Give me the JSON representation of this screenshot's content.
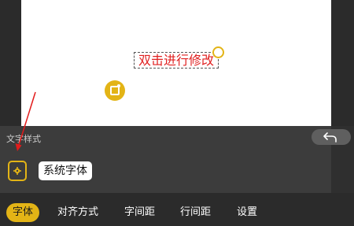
{
  "canvas": {
    "text_content": "双击进行修改",
    "text_color": "#e02020",
    "handle_color": "#e3b416"
  },
  "style_panel": {
    "title": "文字样式",
    "undo_icon": "undo-icon",
    "settings_icon": "gear-icon",
    "current_font": "系统字体"
  },
  "tabs": [
    {
      "label": "字体",
      "active": true
    },
    {
      "label": "对齐方式",
      "active": false
    },
    {
      "label": "字间距",
      "active": false
    },
    {
      "label": "行间距",
      "active": false
    },
    {
      "label": "设置",
      "active": false
    }
  ],
  "colors": {
    "accent": "#e3b416",
    "annotation_arrow": "#e21b1b"
  }
}
